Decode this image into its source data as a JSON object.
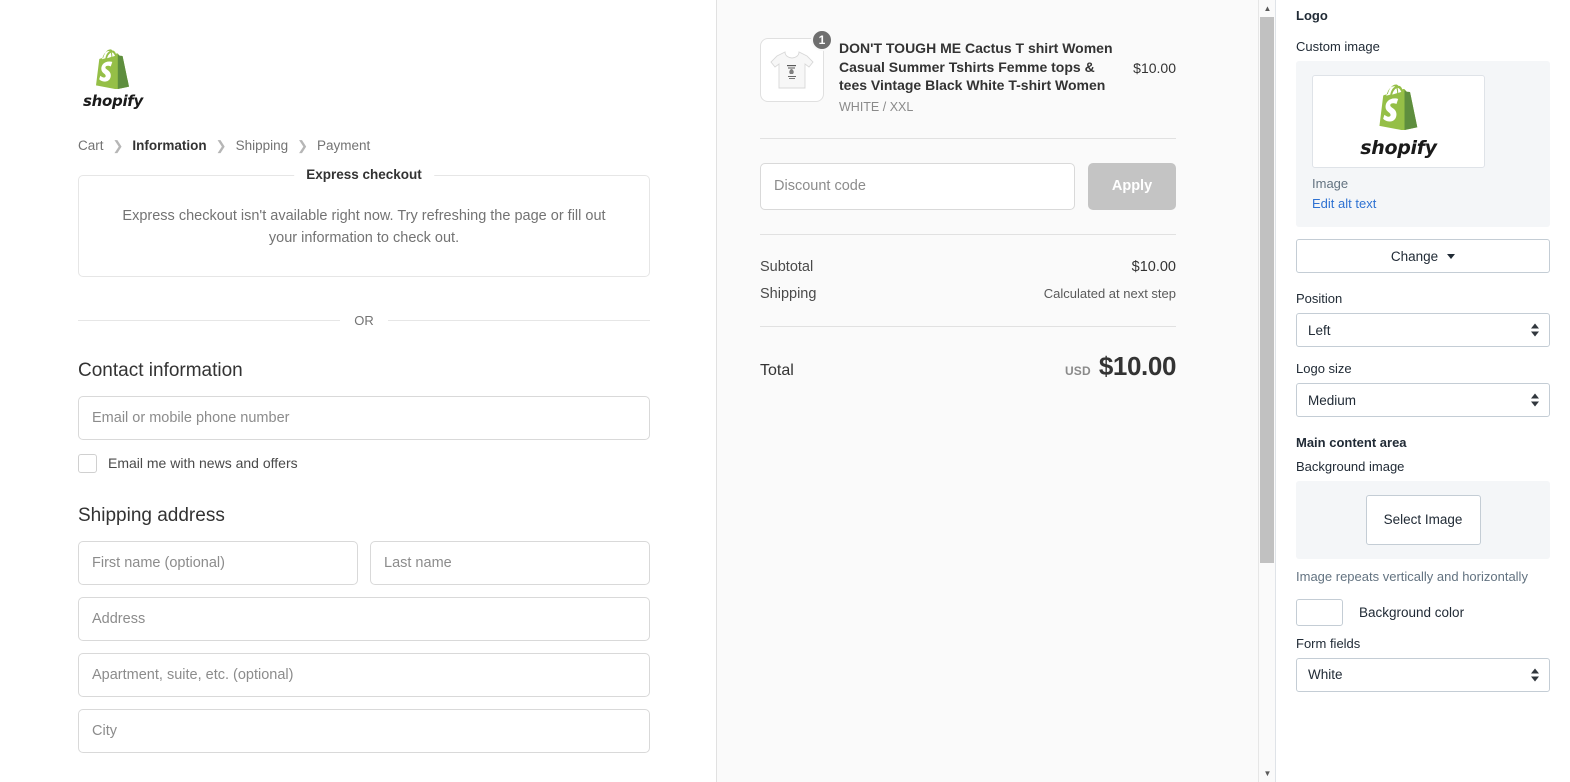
{
  "checkout": {
    "logo": {
      "word": "shopify",
      "icon": "shopify-bag-icon"
    },
    "breadcrumb": [
      {
        "label": "Cart",
        "current": false
      },
      {
        "label": "Information",
        "current": true
      },
      {
        "label": "Shipping",
        "current": false
      },
      {
        "label": "Payment",
        "current": false
      }
    ],
    "express": {
      "legend": "Express checkout",
      "message": "Express checkout isn't available right now. Try refreshing the page or fill out your information to check out."
    },
    "or_text": "OR",
    "contact": {
      "title": "Contact information",
      "email_placeholder": "Email or mobile phone number",
      "email_value": "",
      "newsletter_label": "Email me with news and offers",
      "newsletter_checked": false
    },
    "shipping": {
      "title": "Shipping address",
      "first_name_placeholder": "First name (optional)",
      "last_name_placeholder": "Last name",
      "address_placeholder": "Address",
      "apartment_placeholder": "Apartment, suite, etc. (optional)",
      "city_placeholder": "City"
    }
  },
  "summary": {
    "item": {
      "title": "DON'T TOUGH ME Cactus T shirt Women Casual Summer Tshirts Femme tops & tees Vintage Black White T-shirt Women",
      "variant": "WHITE / XXL",
      "quantity": "1",
      "price": "$10.00"
    },
    "discount": {
      "placeholder": "Discount code",
      "value": "",
      "apply_label": "Apply"
    },
    "subtotal_label": "Subtotal",
    "subtotal_value": "$10.00",
    "shipping_label": "Shipping",
    "shipping_value": "Calculated at next step",
    "total_label": "Total",
    "total_currency": "USD",
    "total_value": "$10.00"
  },
  "sidebar": {
    "logo_heading": "Logo",
    "custom_image_label": "Custom image",
    "image_caption": "Image",
    "edit_alt_text": "Edit alt text",
    "change_label": "Change",
    "position_label": "Position",
    "position_value": "Left",
    "logo_size_label": "Logo size",
    "logo_size_value": "Medium",
    "main_content_heading": "Main content area",
    "background_image_label": "Background image",
    "select_image_label": "Select Image",
    "repeat_note": "Image repeats vertically and horizontally",
    "background_color_label": "Background color",
    "background_color_value": "#ffffff",
    "form_fields_label": "Form fields",
    "form_fields_value": "White"
  },
  "colors": {
    "accent_link": "#2e72d2",
    "brand_green": "#95bf47",
    "disabled_button": "#c4c4c4",
    "summary_bg": "#fafafa",
    "panel_bg": "#f4f6f8"
  }
}
